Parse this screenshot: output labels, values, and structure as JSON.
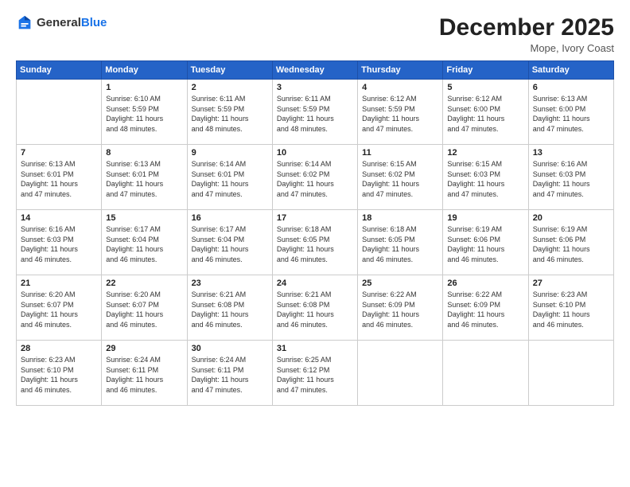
{
  "header": {
    "logo": {
      "general": "General",
      "blue": "Blue"
    },
    "title": "December 2025",
    "location": "Mope, Ivory Coast"
  },
  "weekdays": [
    "Sunday",
    "Monday",
    "Tuesday",
    "Wednesday",
    "Thursday",
    "Friday",
    "Saturday"
  ],
  "weeks": [
    [
      {
        "day": "",
        "info": ""
      },
      {
        "day": "1",
        "info": "Sunrise: 6:10 AM\nSunset: 5:59 PM\nDaylight: 11 hours\nand 48 minutes."
      },
      {
        "day": "2",
        "info": "Sunrise: 6:11 AM\nSunset: 5:59 PM\nDaylight: 11 hours\nand 48 minutes."
      },
      {
        "day": "3",
        "info": "Sunrise: 6:11 AM\nSunset: 5:59 PM\nDaylight: 11 hours\nand 48 minutes."
      },
      {
        "day": "4",
        "info": "Sunrise: 6:12 AM\nSunset: 5:59 PM\nDaylight: 11 hours\nand 47 minutes."
      },
      {
        "day": "5",
        "info": "Sunrise: 6:12 AM\nSunset: 6:00 PM\nDaylight: 11 hours\nand 47 minutes."
      },
      {
        "day": "6",
        "info": "Sunrise: 6:13 AM\nSunset: 6:00 PM\nDaylight: 11 hours\nand 47 minutes."
      }
    ],
    [
      {
        "day": "7",
        "info": "Sunrise: 6:13 AM\nSunset: 6:01 PM\nDaylight: 11 hours\nand 47 minutes."
      },
      {
        "day": "8",
        "info": "Sunrise: 6:13 AM\nSunset: 6:01 PM\nDaylight: 11 hours\nand 47 minutes."
      },
      {
        "day": "9",
        "info": "Sunrise: 6:14 AM\nSunset: 6:01 PM\nDaylight: 11 hours\nand 47 minutes."
      },
      {
        "day": "10",
        "info": "Sunrise: 6:14 AM\nSunset: 6:02 PM\nDaylight: 11 hours\nand 47 minutes."
      },
      {
        "day": "11",
        "info": "Sunrise: 6:15 AM\nSunset: 6:02 PM\nDaylight: 11 hours\nand 47 minutes."
      },
      {
        "day": "12",
        "info": "Sunrise: 6:15 AM\nSunset: 6:03 PM\nDaylight: 11 hours\nand 47 minutes."
      },
      {
        "day": "13",
        "info": "Sunrise: 6:16 AM\nSunset: 6:03 PM\nDaylight: 11 hours\nand 47 minutes."
      }
    ],
    [
      {
        "day": "14",
        "info": "Sunrise: 6:16 AM\nSunset: 6:03 PM\nDaylight: 11 hours\nand 46 minutes."
      },
      {
        "day": "15",
        "info": "Sunrise: 6:17 AM\nSunset: 6:04 PM\nDaylight: 11 hours\nand 46 minutes."
      },
      {
        "day": "16",
        "info": "Sunrise: 6:17 AM\nSunset: 6:04 PM\nDaylight: 11 hours\nand 46 minutes."
      },
      {
        "day": "17",
        "info": "Sunrise: 6:18 AM\nSunset: 6:05 PM\nDaylight: 11 hours\nand 46 minutes."
      },
      {
        "day": "18",
        "info": "Sunrise: 6:18 AM\nSunset: 6:05 PM\nDaylight: 11 hours\nand 46 minutes."
      },
      {
        "day": "19",
        "info": "Sunrise: 6:19 AM\nSunset: 6:06 PM\nDaylight: 11 hours\nand 46 minutes."
      },
      {
        "day": "20",
        "info": "Sunrise: 6:19 AM\nSunset: 6:06 PM\nDaylight: 11 hours\nand 46 minutes."
      }
    ],
    [
      {
        "day": "21",
        "info": "Sunrise: 6:20 AM\nSunset: 6:07 PM\nDaylight: 11 hours\nand 46 minutes."
      },
      {
        "day": "22",
        "info": "Sunrise: 6:20 AM\nSunset: 6:07 PM\nDaylight: 11 hours\nand 46 minutes."
      },
      {
        "day": "23",
        "info": "Sunrise: 6:21 AM\nSunset: 6:08 PM\nDaylight: 11 hours\nand 46 minutes."
      },
      {
        "day": "24",
        "info": "Sunrise: 6:21 AM\nSunset: 6:08 PM\nDaylight: 11 hours\nand 46 minutes."
      },
      {
        "day": "25",
        "info": "Sunrise: 6:22 AM\nSunset: 6:09 PM\nDaylight: 11 hours\nand 46 minutes."
      },
      {
        "day": "26",
        "info": "Sunrise: 6:22 AM\nSunset: 6:09 PM\nDaylight: 11 hours\nand 46 minutes."
      },
      {
        "day": "27",
        "info": "Sunrise: 6:23 AM\nSunset: 6:10 PM\nDaylight: 11 hours\nand 46 minutes."
      }
    ],
    [
      {
        "day": "28",
        "info": "Sunrise: 6:23 AM\nSunset: 6:10 PM\nDaylight: 11 hours\nand 46 minutes."
      },
      {
        "day": "29",
        "info": "Sunrise: 6:24 AM\nSunset: 6:11 PM\nDaylight: 11 hours\nand 46 minutes."
      },
      {
        "day": "30",
        "info": "Sunrise: 6:24 AM\nSunset: 6:11 PM\nDaylight: 11 hours\nand 47 minutes."
      },
      {
        "day": "31",
        "info": "Sunrise: 6:25 AM\nSunset: 6:12 PM\nDaylight: 11 hours\nand 47 minutes."
      },
      {
        "day": "",
        "info": ""
      },
      {
        "day": "",
        "info": ""
      },
      {
        "day": "",
        "info": ""
      }
    ]
  ]
}
